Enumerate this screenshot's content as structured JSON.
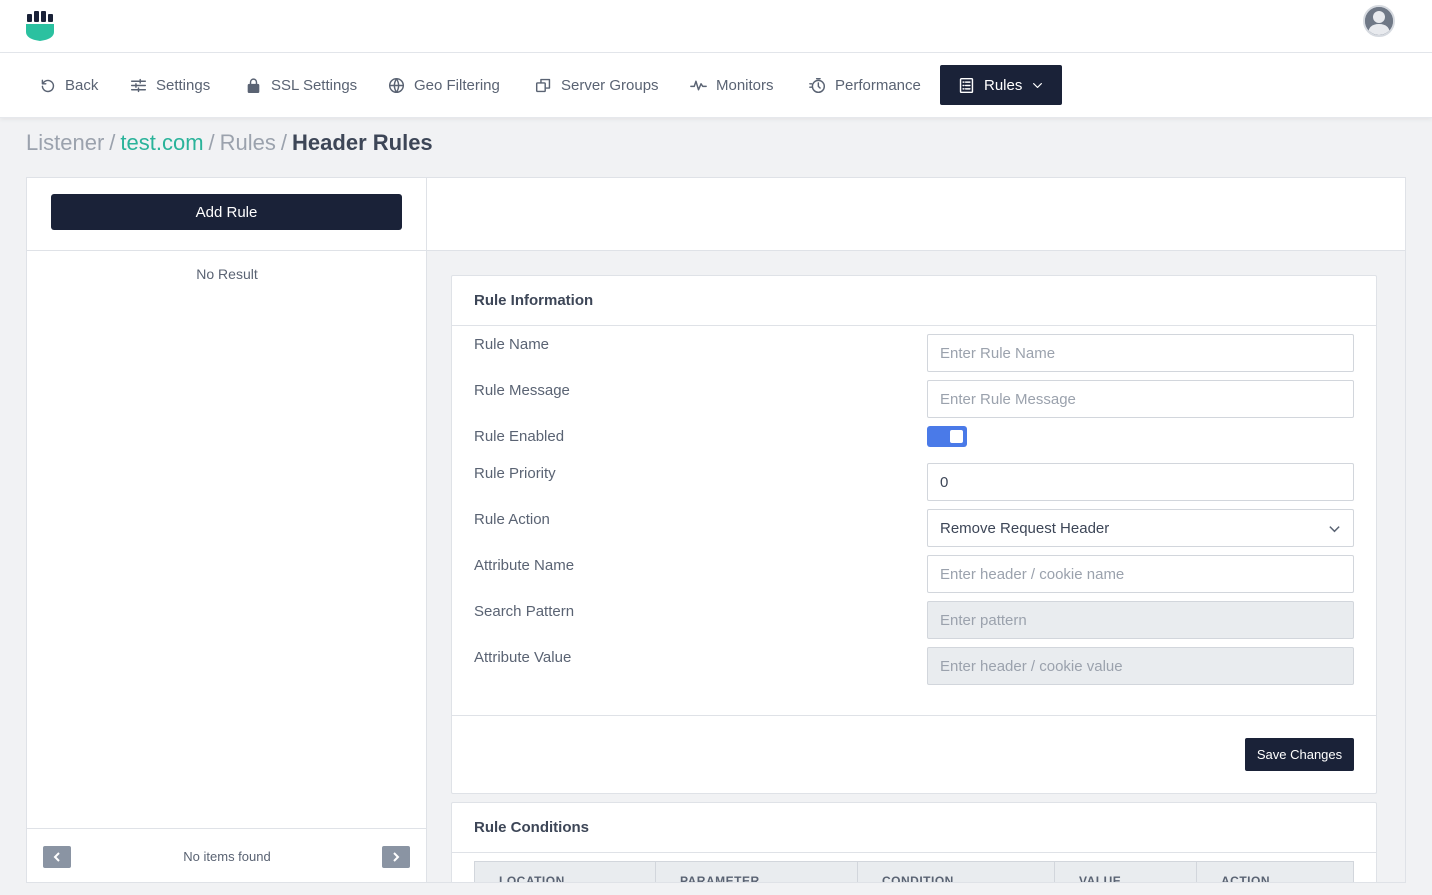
{
  "app": {
    "brand_colors": {
      "primary": "#1a2238",
      "accent": "#2ab39a",
      "toggle": "#4a7ae8"
    }
  },
  "nav": {
    "items": [
      {
        "label": "Back",
        "icon": "undo-icon"
      },
      {
        "label": "Settings",
        "icon": "sliders-icon"
      },
      {
        "label": "SSL Settings",
        "icon": "lock-icon"
      },
      {
        "label": "Geo Filtering",
        "icon": "globe-icon"
      },
      {
        "label": "Server Groups",
        "icon": "copy-icon"
      },
      {
        "label": "Monitors",
        "icon": "pulse-icon"
      },
      {
        "label": "Performance",
        "icon": "stopwatch-icon"
      },
      {
        "label": "Rules",
        "icon": "list-icon",
        "active": true
      }
    ]
  },
  "breadcrumb": {
    "root": "Listener",
    "listener": "test.com",
    "section": "Rules",
    "current": "Header Rules",
    "separator": "/"
  },
  "left": {
    "add_label": "Add Rule",
    "empty_text": "No Result",
    "footer_text": "No items found"
  },
  "rule_info": {
    "title": "Rule Information",
    "name": {
      "label": "Rule Name",
      "placeholder": "Enter Rule Name"
    },
    "message": {
      "label": "Rule Message",
      "placeholder": "Enter Rule Message"
    },
    "enabled": {
      "label": "Rule Enabled",
      "value": true
    },
    "priority": {
      "label": "Rule Priority",
      "value": "0"
    },
    "action": {
      "label": "Rule Action",
      "value": "Remove Request Header"
    },
    "attr_name": {
      "label": "Attribute Name",
      "placeholder": "Enter header / cookie name"
    },
    "pattern": {
      "label": "Search Pattern",
      "placeholder": "Enter pattern"
    },
    "attr_value": {
      "label": "Attribute Value",
      "placeholder": "Enter header / cookie value"
    },
    "save_label": "Save Changes"
  },
  "conditions": {
    "title": "Rule Conditions",
    "columns": [
      "LOCATION",
      "PARAMETER",
      "CONDITION",
      "VALUE",
      "ACTION"
    ]
  }
}
